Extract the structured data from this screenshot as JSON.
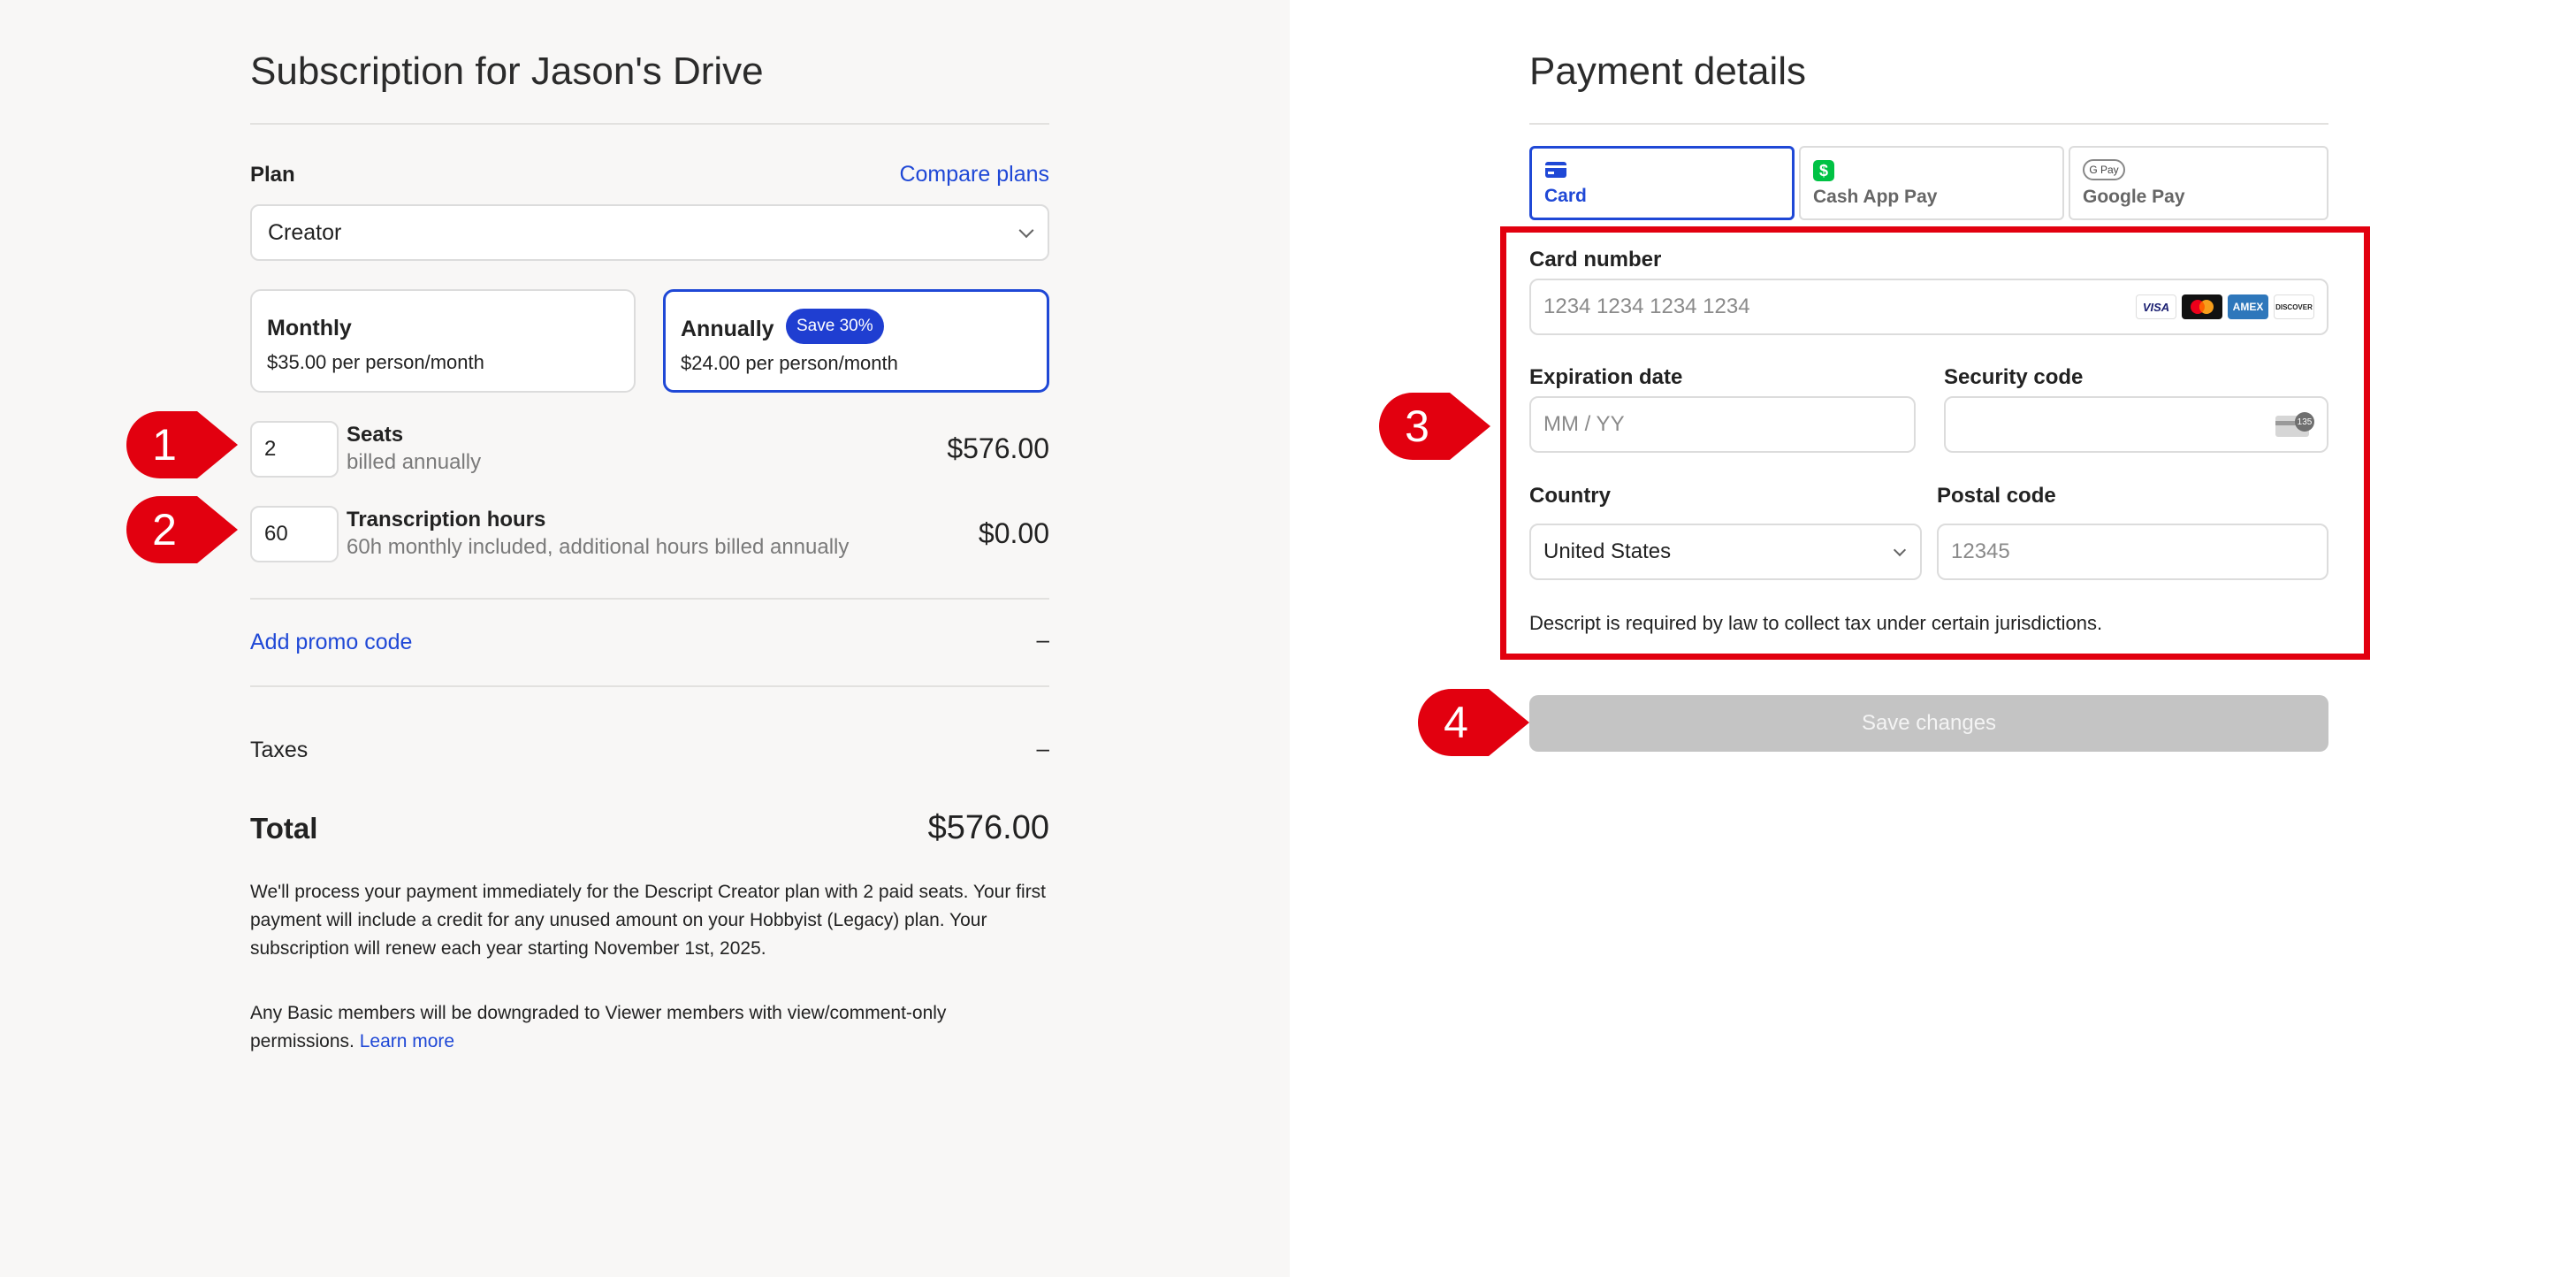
{
  "subscription": {
    "title": "Subscription for Jason's Drive",
    "plan_label": "Plan",
    "compare_link": "Compare plans",
    "plan_selected": "Creator",
    "billing": {
      "monthly": {
        "title": "Monthly",
        "price": "$35.00 per person/month"
      },
      "annually": {
        "title": "Annually",
        "badge": "Save 30%",
        "price": "$24.00 per person/month"
      }
    },
    "seats": {
      "value": "2",
      "title": "Seats",
      "subtitle": "billed annually",
      "price": "$576.00"
    },
    "transcription": {
      "value": "60",
      "title": "Transcription hours",
      "subtitle": "60h monthly included, additional hours billed annually",
      "price": "$0.00"
    },
    "promo_link": "Add promo code",
    "promo_value": "–",
    "taxes_label": "Taxes",
    "taxes_value": "–",
    "total_label": "Total",
    "total_value": "$576.00",
    "notice_1": "We'll process your payment immediately for the Descript Creator plan with 2 paid seats. Your first payment will include a credit for any unused amount on your Hobbyist (Legacy) plan. Your subscription will renew each year starting November 1st, 2025.",
    "notice_2": "Any Basic members will be downgraded to Viewer members with view/comment-only permissions.",
    "learn_more": "Learn more"
  },
  "payment": {
    "title": "Payment details",
    "tabs": [
      {
        "label": "Card",
        "icon": "credit-card-icon",
        "active": true
      },
      {
        "label": "Cash App Pay",
        "icon": "cash-app-icon",
        "active": false
      },
      {
        "label": "Google Pay",
        "icon": "google-pay-icon",
        "active": false
      }
    ],
    "cashapp_glyph": "$",
    "gpay_glyph": "G Pay",
    "card_number_label": "Card number",
    "card_number_placeholder": "1234 1234 1234 1234",
    "card_brands": [
      "VISA",
      "mastercard",
      "AMEX",
      "DISCOVER"
    ],
    "expiration_label": "Expiration date",
    "expiration_placeholder": "MM / YY",
    "security_label": "Security code",
    "cvc_glyph": "135",
    "country_label": "Country",
    "country_value": "United States",
    "postal_label": "Postal code",
    "postal_placeholder": "12345",
    "tax_notice": "Descript is required by law to collect tax under certain jurisdictions.",
    "save_button": "Save changes"
  },
  "callouts": [
    "1",
    "2",
    "3",
    "4"
  ],
  "colors": {
    "accent": "#1f48d6",
    "badge": "#1f3ed1",
    "callout_red": "#e2000f",
    "disabled_button": "#c4c4c4",
    "left_background": "#f8f7f6"
  }
}
